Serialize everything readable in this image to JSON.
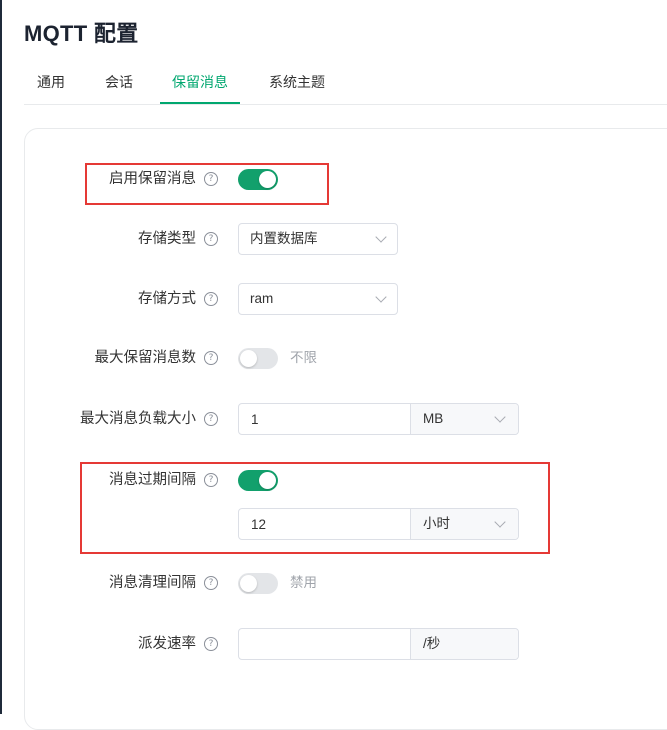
{
  "page": {
    "title": "MQTT 配置"
  },
  "tabs": [
    {
      "label": "通用",
      "active": false
    },
    {
      "label": "会话",
      "active": false
    },
    {
      "label": "保留消息",
      "active": true
    },
    {
      "label": "系统主题",
      "active": false
    }
  ],
  "form": {
    "enable_retained": {
      "label": "启用保留消息",
      "help": "?",
      "enabled": true
    },
    "storage_type": {
      "label": "存储类型",
      "help": "?",
      "value": "内置数据库"
    },
    "storage_mode": {
      "label": "存储方式",
      "help": "?",
      "value": "ram"
    },
    "max_retained": {
      "label": "最大保留消息数",
      "help": "?",
      "enabled": false,
      "text": "不限"
    },
    "max_payload": {
      "label": "最大消息负载大小",
      "help": "?",
      "value": "1",
      "unit": "MB"
    },
    "expiry_interval": {
      "label": "消息过期间隔",
      "help": "?",
      "enabled": true,
      "value": "12",
      "unit": "小时"
    },
    "clean_interval": {
      "label": "消息清理间隔",
      "help": "?",
      "enabled": false,
      "text": "禁用"
    },
    "dispatch_rate": {
      "label": "派发速率",
      "help": "?",
      "value": "",
      "unit": "/秒"
    }
  },
  "colors": {
    "accent": "#00a76f",
    "toggle_on": "#12a06c",
    "toggle_off": "#e3e5e8",
    "highlight": "#e53935"
  }
}
